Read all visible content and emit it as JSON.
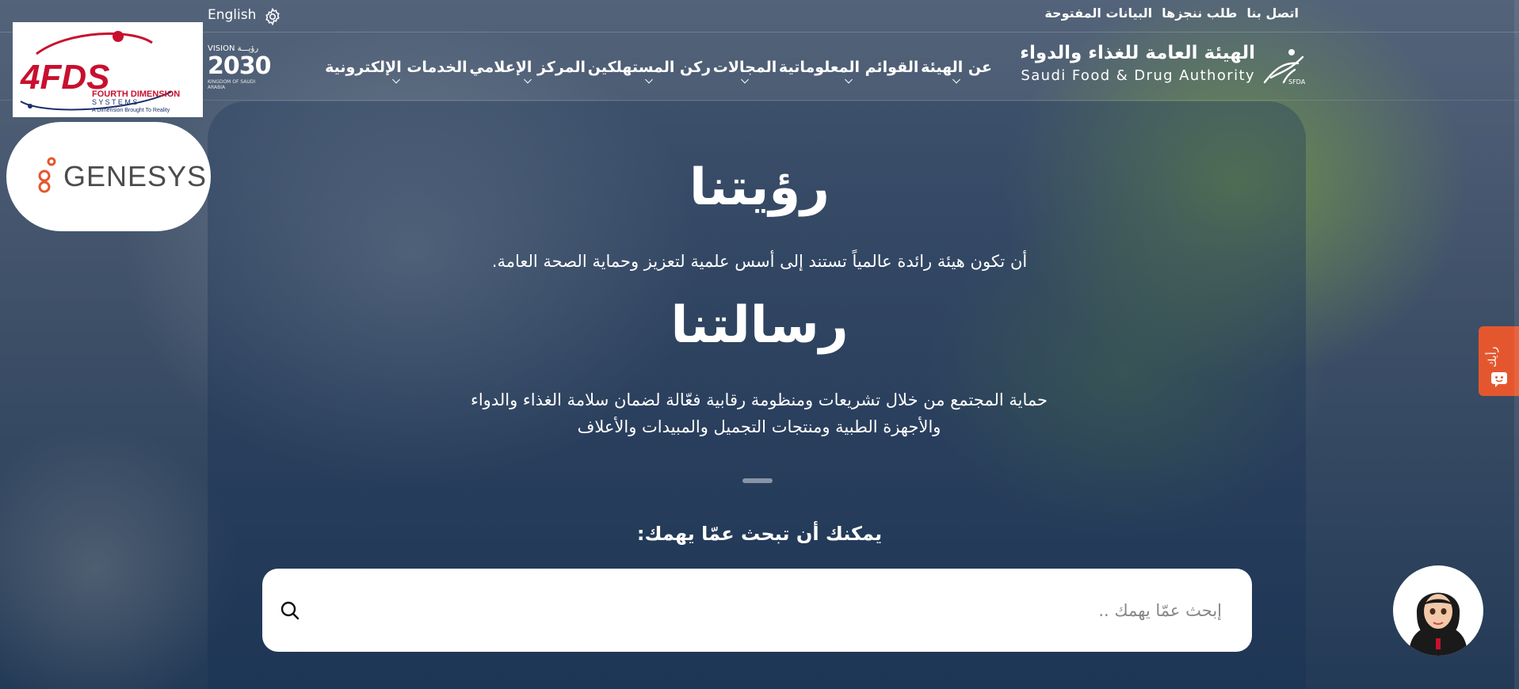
{
  "topbar": {
    "links": [
      "اتصل بنا",
      "طلب ننجزها",
      "البيانات المفتوحة"
    ],
    "language": "English"
  },
  "logo": {
    "arabic": "الهيئة العامة للغذاء والدواء",
    "english": "Saudi Food & Drug Authority",
    "mark_label": "SFDA"
  },
  "vision_logo": {
    "line1": "VISION رؤيـــة",
    "line2": "2030",
    "line3": "KINGDOM OF SAUDI ARABIA"
  },
  "nav": {
    "items": [
      "عن الهيئة",
      "القوائم المعلوماتية",
      "المجالات",
      "ركن المستهلكين",
      "المركز الإعلامي",
      "الخدمات الإلكترونية"
    ]
  },
  "badges": {
    "fourfds": {
      "name": "4FDS",
      "line1": "FOURTH DIMENSION",
      "line2": "S Y S T E M S",
      "line3": "A Dimension Brought To Reality"
    },
    "genesys": "GENESYS"
  },
  "hero": {
    "vision_title": "رؤيتنا",
    "vision_text": "أن تكون هيئة رائدة عالمياً تستند إلى أسس علمية لتعزيز وحماية الصحة العامة.",
    "mission_title": "رسالتنا",
    "mission_text": "حماية المجتمع من خلال تشريعات ومنظومة رقابية فعّالة لضمان سلامة الغذاء والدواء والأجهزة الطبية ومنتجات التجميل والمبيدات والأعلاف"
  },
  "search": {
    "label": "يمكنك أن تبحث عمّا يهمك:",
    "placeholder": "إبحث عمّا يهمك .."
  },
  "feedback": {
    "label": "رأيك"
  },
  "colors": {
    "accent": "#e4572e",
    "brand_red": "#c8102e",
    "brand_navy": "#1b2f6b"
  },
  "icons": [
    "gear-icon",
    "search-icon",
    "chevron-down-icon",
    "chat-icon"
  ]
}
